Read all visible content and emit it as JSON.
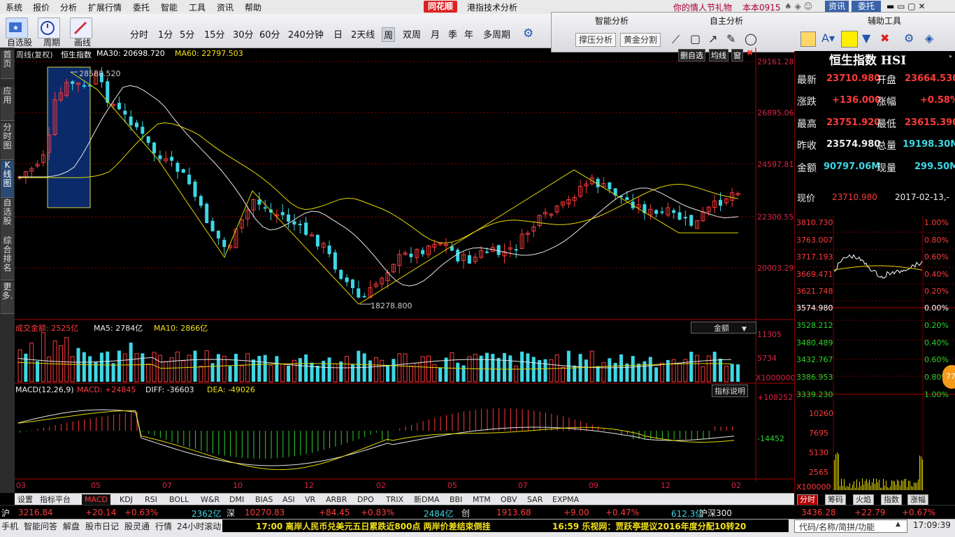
{
  "menu": [
    "系统",
    "报价",
    "分析",
    "扩展行情",
    "委托",
    "智能",
    "工具",
    "资讯",
    "帮助"
  ],
  "app_brand": "同花顺",
  "window_title": "港指技术分析",
  "topright": {
    "promo": "你的情人节礼物",
    "user": "本本0915",
    "btn_news": "资讯",
    "btn_trade": "委托"
  },
  "toolbar": {
    "groups": [
      "自选股",
      "周期",
      "画线"
    ],
    "periods": [
      "分时",
      "1分",
      "5分",
      "15分",
      "30分",
      "60分",
      "240分钟",
      "日",
      "2天线",
      "周",
      "双周",
      "月",
      "季",
      "年",
      "多周期"
    ],
    "selected_period": "周"
  },
  "analysis_tools": {
    "smart": "智能分析",
    "self": "自主分析",
    "aux": "辅助工具",
    "btn1": "撑压分析",
    "btn2": "黄金分割"
  },
  "left_tabs": [
    "首页",
    "应用",
    "分时图",
    "K线图",
    "自选股",
    "综合排名",
    "更多."
  ],
  "chart_header": {
    "mode": "周线(复权)",
    "name": "恒生指数",
    "ma30": "MA30: 20698.720",
    "ma60": "MA60: 22797.503",
    "buttons": [
      "删自选",
      "均线",
      "窗"
    ]
  },
  "price_axis": [
    "29161.28",
    "26895.06",
    "24597.81",
    "22300.55",
    "20003.29"
  ],
  "annotations": {
    "high": "28588.520",
    "low": "18278.800"
  },
  "volume_header": {
    "amount": "成交金额: 2525亿",
    "ma5": "MA5: 2784亿",
    "ma10": "MA10: 2866亿",
    "selector": "金额"
  },
  "volume_axis": [
    "11305",
    "5734",
    "X10000000"
  ],
  "macd_header": {
    "title": "MACD(12,26,9)",
    "macd": "MACD: +24845",
    "diff": "DIFF: -36603",
    "dea": "DEA: -49026",
    "explain": "指标说明"
  },
  "macd_axis": [
    "+108252",
    "-14452"
  ],
  "x_axis": [
    "03",
    "05",
    "07",
    "10",
    "12",
    "02",
    "05",
    "07",
    "09",
    "12",
    "02"
  ],
  "bottom_tabs": [
    "设置",
    "指标平台",
    "MACD",
    "KDJ",
    "RSI",
    "BOLL",
    "W&R",
    "DMI",
    "BIAS",
    "ASI",
    "VR",
    "ARBR",
    "DPO",
    "TRIX",
    "新DMA",
    "BBI",
    "MTM",
    "OBV",
    "SAR",
    "EXPMA"
  ],
  "selected_tab": "MACD",
  "quote": {
    "title": "恒生指数 HSI",
    "rows": [
      {
        "l1": "最新",
        "v1": "23710.980",
        "l2": "开盘",
        "v2": "23664.530"
      },
      {
        "l1": "涨跌",
        "v1": "+136.000",
        "l2": "涨幅",
        "v2": "+0.58%"
      },
      {
        "l1": "最高",
        "v1": "23751.920",
        "l2": "最低",
        "v2": "23615.390"
      },
      {
        "l1": "昨收",
        "v1": "23574.980",
        "l2": "总量",
        "v2": "19198.30M"
      },
      {
        "l1": "金额",
        "v1": "90797.06M",
        "l2": "现量",
        "v2": "299.50M"
      }
    ],
    "price_label": "现价",
    "price": "23710.980",
    "date": "2017-02-13,-",
    "mini_left": [
      "3810.730",
      "3763.007",
      "3717.193",
      "3669.471",
      "3621.748",
      "3574.980",
      "3528.212",
      "3480.489",
      "3432.767",
      "3386.953",
      "3339.230"
    ],
    "mini_right": [
      "1.00%",
      "0.80%",
      "0.60%",
      "0.40%",
      "0.20%",
      "0.00%",
      "0.20%",
      "0.40%",
      "0.60%",
      "0.80%",
      "1.00%"
    ],
    "mini_vol": [
      "10260",
      "7695",
      "5130",
      "2565",
      "X100000"
    ],
    "mini_tabs": [
      "分时",
      "筹码",
      "火焰",
      "指数",
      "涨幅"
    ],
    "badge": "77"
  },
  "ticker": {
    "sh": "沪",
    "sh_val": "3216.84",
    "sh_chg": "+20.14",
    "sh_pct": "+0.63%",
    "sh_amt": "2362亿",
    "sz": "深",
    "sz_val": "10270.83",
    "sz_chg": "+84.45",
    "sz_pct": "+0.83%",
    "sz_amt": "2484亿",
    "cy": "创",
    "cy_val": "1913.68",
    "cy_chg": "+9.00",
    "cy_pct": "+0.47%",
    "cy_amt": "612.3亿",
    "hs": "沪深300",
    "hs_val": "3436.28",
    "hs_chg": "+22.79",
    "hs_pct": "+0.67%"
  },
  "status": {
    "items": [
      "手机",
      "智能问答",
      "解盘",
      "股市日记",
      "股灵通",
      "行情",
      "24小时滚动"
    ],
    "news1": "17:00 离岸人民币兑美元五日累跌近800点 两岸价差结束倒挂",
    "news2": "16:59 乐视网：贾跃亭提议2016年度分配10转20",
    "search": "代码/名称/简拼/功能",
    "time": "17:09:39"
  },
  "colors": {
    "up": "#ff3b3b",
    "down": "#3dd7e5",
    "ma30": "#ffffff",
    "ma60": "#f3e21a",
    "box": "#0a2a6a"
  }
}
